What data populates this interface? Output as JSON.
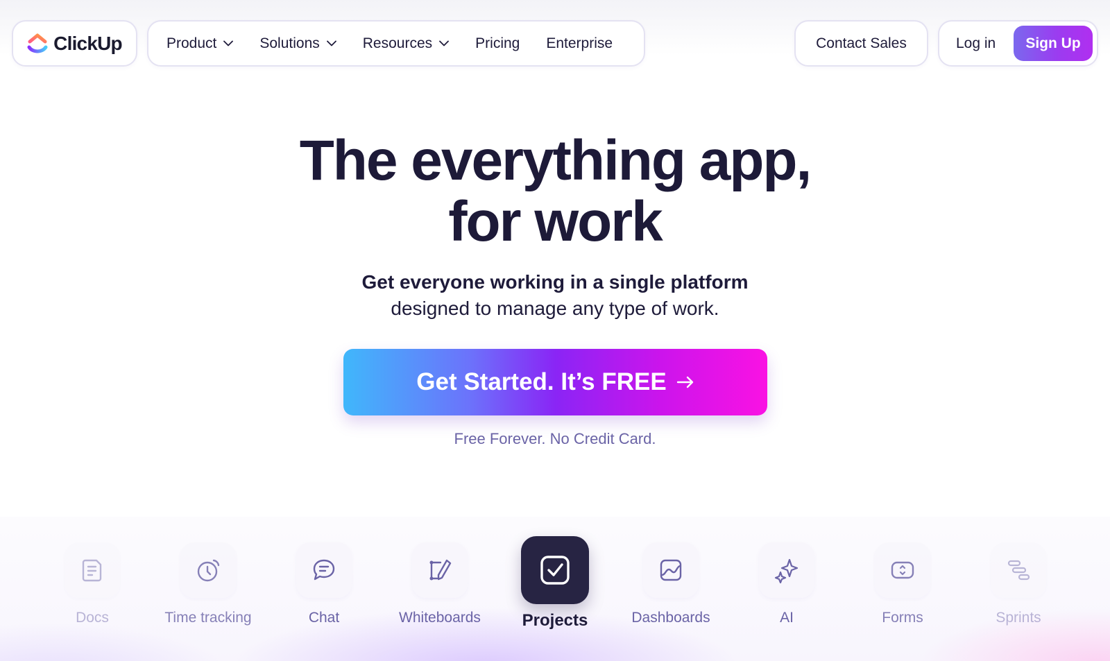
{
  "brand": {
    "name": "ClickUp"
  },
  "nav": {
    "items": [
      {
        "label": "Product",
        "has_dropdown": true
      },
      {
        "label": "Solutions",
        "has_dropdown": true
      },
      {
        "label": "Resources",
        "has_dropdown": true
      },
      {
        "label": "Pricing",
        "has_dropdown": false
      },
      {
        "label": "Enterprise",
        "has_dropdown": false
      }
    ],
    "contact_sales": "Contact Sales",
    "login": "Log in",
    "signup": "Sign Up"
  },
  "hero": {
    "title_line1": "The everything app,",
    "title_line2": "for work",
    "subtitle_bold": "Get everyone working in a single platform",
    "subtitle_rest": "designed to manage any type of work.",
    "cta_label": "Get Started. It’s FREE",
    "note": "Free Forever. No Credit Card."
  },
  "features": [
    {
      "label": "Docs",
      "icon": "doc-icon",
      "active": false
    },
    {
      "label": "Time tracking",
      "icon": "clock-icon",
      "active": false
    },
    {
      "label": "Chat",
      "icon": "chat-bubble-icon",
      "active": false
    },
    {
      "label": "Whiteboards",
      "icon": "whiteboard-pen-icon",
      "active": false
    },
    {
      "label": "Projects",
      "icon": "checkbox-icon",
      "active": true
    },
    {
      "label": "Dashboards",
      "icon": "dashboard-chart-icon",
      "active": false
    },
    {
      "label": "AI",
      "icon": "sparkle-icon",
      "active": false
    },
    {
      "label": "Forms",
      "icon": "form-toggle-icon",
      "active": false
    },
    {
      "label": "Sprints",
      "icon": "sprint-bars-icon",
      "active": false
    }
  ],
  "colors": {
    "text_dark": "#1e1b3a",
    "muted_purple": "#6a63a6",
    "signup_gradient_start": "#7b68ee",
    "cta_gradient_start": "#40b7fb",
    "cta_gradient_end": "#fa12e3",
    "active_tile": "#272443"
  }
}
